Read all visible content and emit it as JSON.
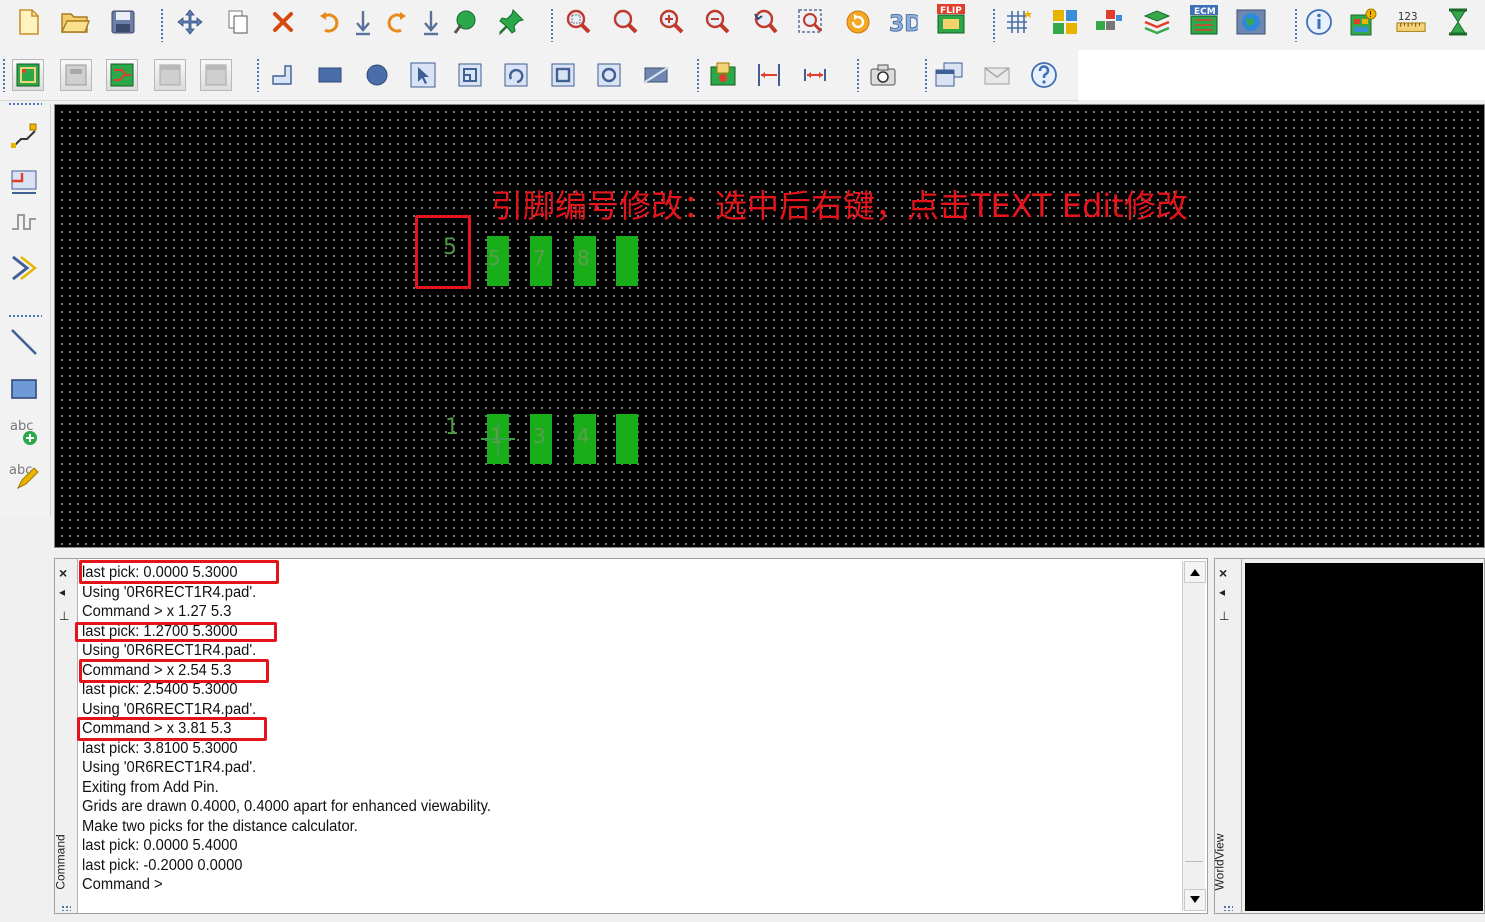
{
  "toolbar_row1": [
    {
      "icon": "new-file-icon",
      "tip": "New"
    },
    {
      "icon": "open-folder-icon",
      "tip": "Open"
    },
    {
      "icon": "save-disk-icon",
      "tip": "Save"
    },
    {
      "icon": "move-icon",
      "tip": "Move"
    },
    {
      "icon": "copy-icon",
      "tip": "Copy"
    },
    {
      "icon": "delete-x-icon",
      "tip": "Delete"
    },
    {
      "icon": "undo-icon",
      "tip": "Undo"
    },
    {
      "icon": "undo-all-icon",
      "tip": "Undo All"
    },
    {
      "icon": "redo-icon",
      "tip": "Redo"
    },
    {
      "icon": "redo-all-icon",
      "tip": "Redo All"
    },
    {
      "icon": "color-icon",
      "tip": "Color"
    },
    {
      "icon": "pin-icon",
      "tip": "Pin"
    },
    {
      "icon": "zoom-area-icon",
      "tip": "Zoom Area"
    },
    {
      "icon": "zoom-fit-icon",
      "tip": "Zoom Fit"
    },
    {
      "icon": "zoom-in-icon",
      "tip": "Zoom In"
    },
    {
      "icon": "zoom-out-icon",
      "tip": "Zoom Out"
    },
    {
      "icon": "zoom-previous-icon",
      "tip": "Zoom Previous"
    },
    {
      "icon": "zoom-center-icon",
      "tip": "Zoom Center"
    },
    {
      "icon": "redraw-icon",
      "tip": "Redraw"
    },
    {
      "icon": "3d-view-icon",
      "tip": "3D"
    },
    {
      "icon": "flip-icon",
      "tip": "Flip"
    },
    {
      "icon": "grid-icon",
      "tip": "Grid"
    },
    {
      "icon": "layout-icon",
      "tip": "Layout"
    },
    {
      "icon": "fanout-icon",
      "tip": "Fanout"
    },
    {
      "icon": "layers-icon",
      "tip": "Layers"
    },
    {
      "icon": "ecm-icon",
      "tip": "ECM"
    },
    {
      "icon": "world-icon",
      "tip": "World"
    },
    {
      "icon": "info-icon",
      "tip": "Info"
    },
    {
      "icon": "property-icon",
      "tip": "Property"
    },
    {
      "icon": "measure-icon",
      "tip": "Measure"
    },
    {
      "icon": "hourglass-icon",
      "tip": "Wait"
    }
  ],
  "toolbar_row1_labels": {
    "three_d": "3D",
    "flip": "FLIP",
    "ecm": "ECM",
    "measure": "123"
  },
  "toolbar_row2": [
    {
      "icon": "board-icon"
    },
    {
      "icon": "place-disabled-icon"
    },
    {
      "icon": "route-icon"
    },
    {
      "icon": "disabled-a-icon"
    },
    {
      "icon": "disabled-b-icon"
    },
    {
      "icon": "corner-line-icon"
    },
    {
      "icon": "rectangle-icon"
    },
    {
      "icon": "circle-icon"
    },
    {
      "icon": "select-arrow-icon"
    },
    {
      "icon": "shape-a-icon"
    },
    {
      "icon": "shape-b-icon"
    },
    {
      "icon": "shape-c-icon"
    },
    {
      "icon": "shape-d-icon"
    },
    {
      "icon": "shape-e-icon"
    },
    {
      "icon": "pad-icon"
    },
    {
      "icon": "dimension-a-icon"
    },
    {
      "icon": "dimension-b-icon"
    },
    {
      "icon": "camera-icon"
    },
    {
      "icon": "window-icon"
    },
    {
      "icon": "mail-icon"
    },
    {
      "icon": "help-icon"
    }
  ],
  "left_tools": [
    {
      "icon": "add-connect-icon"
    },
    {
      "icon": "edit-pin-icon"
    },
    {
      "icon": "slide-icon"
    },
    {
      "icon": "push-icon"
    },
    {
      "icon": "add-line-icon"
    },
    {
      "icon": "add-rect-icon"
    },
    {
      "icon": "add-text-icon"
    },
    {
      "icon": "edit-text-icon"
    }
  ],
  "left_tool_labels": {
    "add_text": "abc",
    "edit_text": "abc"
  },
  "canvas": {
    "annotation": "引脚编号修改：选中后右键，点击TEXT Edit修改",
    "top_row_pin_number": "5",
    "bottom_row_pin_number": "1",
    "top_pad_labels": [
      "5",
      "7",
      "8",
      ""
    ],
    "bottom_pad_labels": [
      "1",
      "3",
      "4",
      ""
    ]
  },
  "command_pane": {
    "title": "Command",
    "close": "×",
    "arrow": "◂",
    "pin": "⊥",
    "lines": [
      "last pick:  0.0000  5.3000",
      "Using '0R6RECT1R4.pad'.",
      "Command > x 1.27 5.3",
      "last pick:  1.2700  5.3000",
      "Using '0R6RECT1R4.pad'.",
      "Command > x 2.54 5.3",
      "last pick:  2.5400  5.3000",
      "Using '0R6RECT1R4.pad'.",
      "Command > x 3.81 5.3",
      "last pick:  3.8100  5.3000",
      "Using '0R6RECT1R4.pad'.",
      "Exiting from Add Pin.",
      "Grids are drawn 0.4000, 0.4000 apart for enhanced viewability.",
      "Make two picks for the distance calculator.",
      "last pick:  0.0000  5.4000",
      "last pick:  -0.2000  0.0000",
      "Command >"
    ]
  },
  "worldview_pane": {
    "title": "WorldView",
    "close": "×",
    "arrow": "◂",
    "pin": "⊥"
  }
}
